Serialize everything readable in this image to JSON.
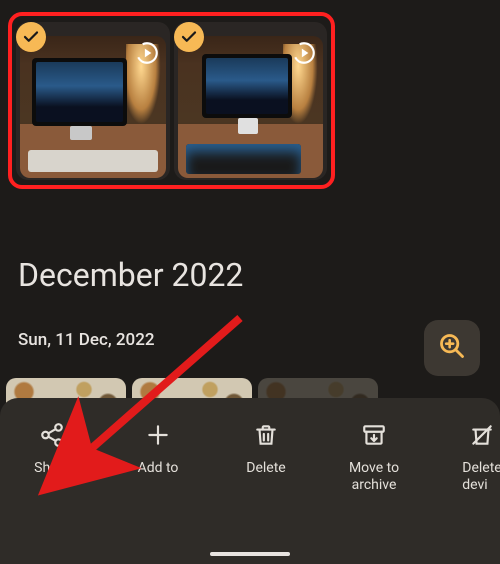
{
  "grid": {
    "selected_count": 2,
    "items": [
      {
        "selected": true,
        "motion_photo": true
      },
      {
        "selected": true,
        "motion_photo": true
      }
    ]
  },
  "month_heading": "December 2022",
  "day_heading": "Sun, 11 Dec, 2022",
  "actions": {
    "share": "Share",
    "add_to": "Add to",
    "delete": "Delete",
    "archive_line1": "Move to",
    "archive_line2": "archive",
    "delete_device_line1": "Delete",
    "delete_device_line2": "devi"
  },
  "colors": {
    "accent": "#f7b955",
    "highlight_border": "#ff2020",
    "surface": "#2f2c28"
  }
}
